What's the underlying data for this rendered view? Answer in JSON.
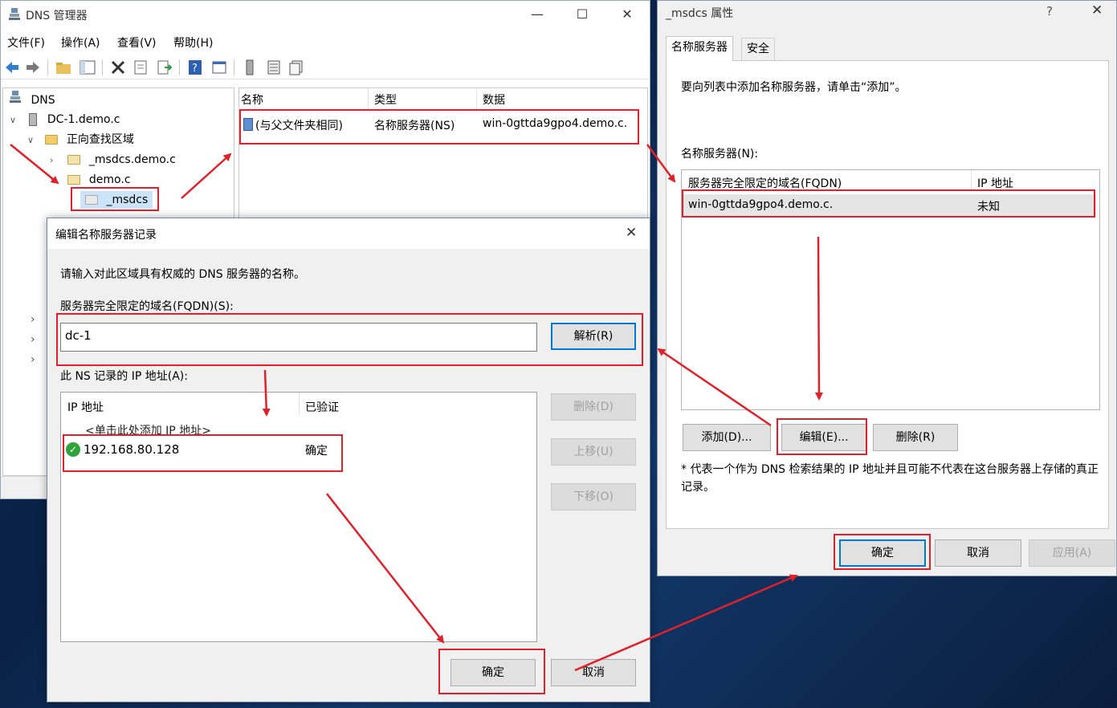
{
  "dns_window": {
    "title": "DNS 管理器",
    "menu": [
      "文件(F)",
      "操作(A)",
      "查看(V)",
      "帮助(H)"
    ],
    "tree": {
      "root": "DNS",
      "server": "DC-1.demo.c",
      "forward_zones": "正向查找区域",
      "zone_msdcs": "_msdcs.demo.c",
      "zone_demo": "demo.c",
      "selected": "_msdcs"
    },
    "list": {
      "columns": [
        "名称",
        "类型",
        "数据"
      ],
      "row": {
        "name": "(与父文件夹相同)",
        "type": "名称服务器(NS)",
        "data": "win-0gttda9gpo4.demo.c."
      }
    }
  },
  "props_window": {
    "title": "_msdcs 属性",
    "help": "?",
    "tabs": [
      "名称服务器",
      "安全"
    ],
    "instruction": "要向列表中添加名称服务器，请单击“添加”。",
    "ns_label": "名称服务器(N):",
    "columns": [
      "服务器完全限定的域名(FQDN)",
      "IP 地址"
    ],
    "row": {
      "fqdn": "win-0gttda9gpo4.demo.c.",
      "ip": "未知"
    },
    "buttons": {
      "add": "添加(D)...",
      "edit": "编辑(E)...",
      "remove": "删除(R)"
    },
    "note": "* 代表一个作为 DNS 检索结果的 IP 地址并且可能不代表在这台服务器上存储的真正记录。",
    "footer": {
      "ok": "确定",
      "cancel": "取消",
      "apply": "应用(A)"
    }
  },
  "edit_dialog": {
    "title": "编辑名称服务器记录",
    "prompt": "请输入对此区域具有权威的 DNS 服务器的名称。",
    "fqdn_label": "服务器完全限定的域名(FQDN)(S):",
    "fqdn_value": "dc-1",
    "resolve_button": "解析(R)",
    "ip_label": "此 NS 记录的 IP 地址(A):",
    "columns": [
      "IP 地址",
      "已验证"
    ],
    "add_hint": "<单击此处添加 IP 地址>",
    "ip_row": {
      "ip": "192.168.80.128",
      "status": "确定"
    },
    "side_buttons": {
      "delete": "删除(D)",
      "up": "上移(U)",
      "down": "下移(O)"
    },
    "ok": "确定",
    "cancel": "取消"
  },
  "colors": {
    "highlight": "#e0202a",
    "accent": "#0078d7",
    "verified": "#2ea23b"
  }
}
